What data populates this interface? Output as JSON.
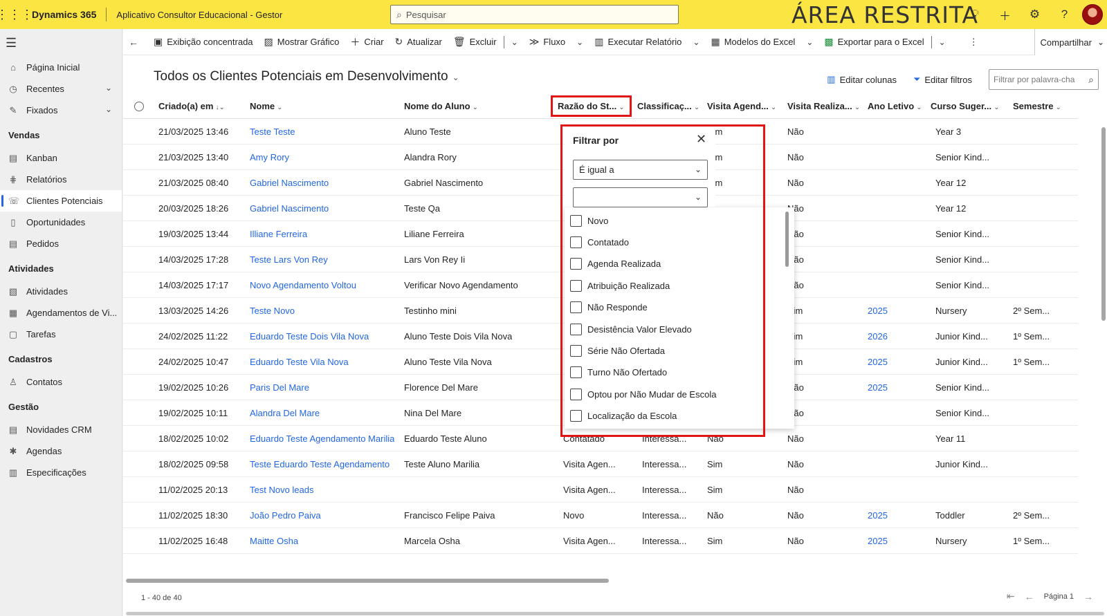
{
  "topbar": {
    "brand": "Dynamics 365",
    "app_name": "Aplicativo Consultor Educacional - Gestor",
    "search_placeholder": "Pesquisar",
    "banner": "ÁREA RESTRITA"
  },
  "sidebar": {
    "top_items": [
      {
        "label": "Página Inicial",
        "icon": "home-icon"
      },
      {
        "label": "Recentes",
        "icon": "clock-icon"
      },
      {
        "label": "Fixados",
        "icon": "pin-icon"
      }
    ],
    "sections": [
      {
        "title": "Vendas",
        "items": [
          {
            "label": "Kanban"
          },
          {
            "label": "Relatórios"
          },
          {
            "label": "Clientes Potenciais",
            "active": true
          },
          {
            "label": "Oportunidades"
          },
          {
            "label": "Pedidos"
          }
        ]
      },
      {
        "title": "Atividades",
        "items": [
          {
            "label": "Atividades"
          },
          {
            "label": "Agendamentos de Vi..."
          },
          {
            "label": "Tarefas"
          }
        ]
      },
      {
        "title": "Cadastros",
        "items": [
          {
            "label": "Contatos"
          }
        ]
      },
      {
        "title": "Gestão",
        "items": [
          {
            "label": "Novidades CRM"
          },
          {
            "label": "Agendas"
          },
          {
            "label": "Especificações"
          }
        ]
      }
    ]
  },
  "commandbar": {
    "items": [
      "Exibição concentrada",
      "Mostrar Gráfico",
      "Criar",
      "Atualizar",
      "Excluir",
      "Fluxo",
      "Executar Relatório",
      "Modelos do Excel",
      "Exportar para o Excel"
    ],
    "share": "Compartilhar"
  },
  "view": {
    "title": "Todos os Clientes Potenciais em Desenvolvimento",
    "edit_columns": "Editar colunas",
    "edit_filters": "Editar filtros",
    "keyword_placeholder": "Filtrar por palavra-cha"
  },
  "grid": {
    "columns": [
      "Criado(a) em",
      "Nome",
      "Nome do Aluno",
      "Razão do St...",
      "Classificaç...",
      "Visita Agend...",
      "Visita Realiza...",
      "Ano Letivo",
      "Curso Suger...",
      "Semestre"
    ],
    "rows": [
      [
        "21/03/2025 13:46",
        "Teste Teste",
        "Aluno Teste",
        "",
        "",
        "Sim",
        "Não",
        "",
        "Year 3",
        ""
      ],
      [
        "21/03/2025 13:40",
        "Amy Rory",
        "Alandra Rory",
        "",
        "",
        "Sim",
        "Não",
        "",
        "Senior Kind...",
        ""
      ],
      [
        "21/03/2025 08:40",
        "Gabriel Nascimento",
        "Gabriel Nascimento",
        "",
        "",
        "Sim",
        "Não",
        "",
        "Year 12",
        ""
      ],
      [
        "20/03/2025 18:26",
        "Gabriel Nascimento",
        "Teste Qa",
        "",
        "",
        "",
        "Não",
        "",
        "Year 12",
        ""
      ],
      [
        "19/03/2025 13:44",
        "Illiane Ferreira",
        "Liliane Ferreira",
        "",
        "",
        "",
        "Não",
        "",
        "Senior Kind...",
        ""
      ],
      [
        "14/03/2025 17:28",
        "Teste Lars Von Rey",
        "Lars Von Rey Ii",
        "",
        "",
        "",
        "Não",
        "",
        "Senior Kind...",
        ""
      ],
      [
        "14/03/2025 17:17",
        "Novo Agendamento Voltou",
        "Verificar Novo Agendamento",
        "",
        "",
        "",
        "Não",
        "",
        "Senior Kind...",
        ""
      ],
      [
        "13/03/2025 14:26",
        "Teste Novo",
        "Testinho mini",
        "",
        "",
        "",
        "Sim",
        "2025",
        "Nursery",
        "2º Sem..."
      ],
      [
        "24/02/2025 11:22",
        "Eduardo Teste Dois Vila Nova",
        "Aluno Teste Dois Vila Nova",
        "",
        "",
        "",
        "Sim",
        "2026",
        "Junior Kind...",
        "1º Sem..."
      ],
      [
        "24/02/2025 10:47",
        "Eduardo Teste Vila Nova",
        "Aluno Teste Vila Nova",
        "",
        "",
        "",
        "Sim",
        "2025",
        "Junior Kind...",
        "1º Sem..."
      ],
      [
        "19/02/2025 10:26",
        "Paris Del Mare",
        "Florence Del Mare",
        "",
        "",
        "",
        "Não",
        "2025",
        "Senior Kind...",
        ""
      ],
      [
        "19/02/2025 10:11",
        "Alandra Del Mare",
        "Nina Del Mare",
        "",
        "",
        "",
        "Não",
        "",
        "Senior Kind...",
        ""
      ],
      [
        "18/02/2025 10:02",
        "Eduardo Teste Agendamento Marilia",
        "Eduardo Teste Aluno",
        "Contatado",
        "Interessa...",
        "Não",
        "Não",
        "",
        "Year 11",
        ""
      ],
      [
        "18/02/2025 09:58",
        "Teste Eduardo Teste Agendamento",
        "Teste Aluno Marilia",
        "Visita Agen...",
        "Interessa...",
        "Sim",
        "Não",
        "",
        "Junior Kind...",
        ""
      ],
      [
        "11/02/2025 20:13",
        "Test Novo leads",
        "",
        "Visita Agen...",
        "Interessa...",
        "Sim",
        "Não",
        "",
        "",
        ""
      ],
      [
        "11/02/2025 18:30",
        "João Pedro Paiva",
        "Francisco Felipe Paiva",
        "Novo",
        "Interessa...",
        "Não",
        "Não",
        "2025",
        "Toddler",
        "2º Sem..."
      ],
      [
        "11/02/2025 16:48",
        "Maitte Osha",
        "Marcela Osha",
        "Visita Agen...",
        "Interessa...",
        "Sim",
        "Não",
        "2025",
        "Nursery",
        "1º Sem..."
      ]
    ]
  },
  "filter": {
    "title": "Filtrar por",
    "operator": "É igual a",
    "value": "",
    "options": [
      "Novo",
      "Contatado",
      "Agenda Realizada",
      "Atribuição Realizada",
      "Não Responde",
      "Desistência Valor Elevado",
      "Série Não Ofertada",
      "Turno Não Ofertado",
      "Optou por Não Mudar de Escola",
      "Localização da Escola"
    ]
  },
  "footer": {
    "count": "1 - 40 de 40",
    "page": "Página 1"
  }
}
